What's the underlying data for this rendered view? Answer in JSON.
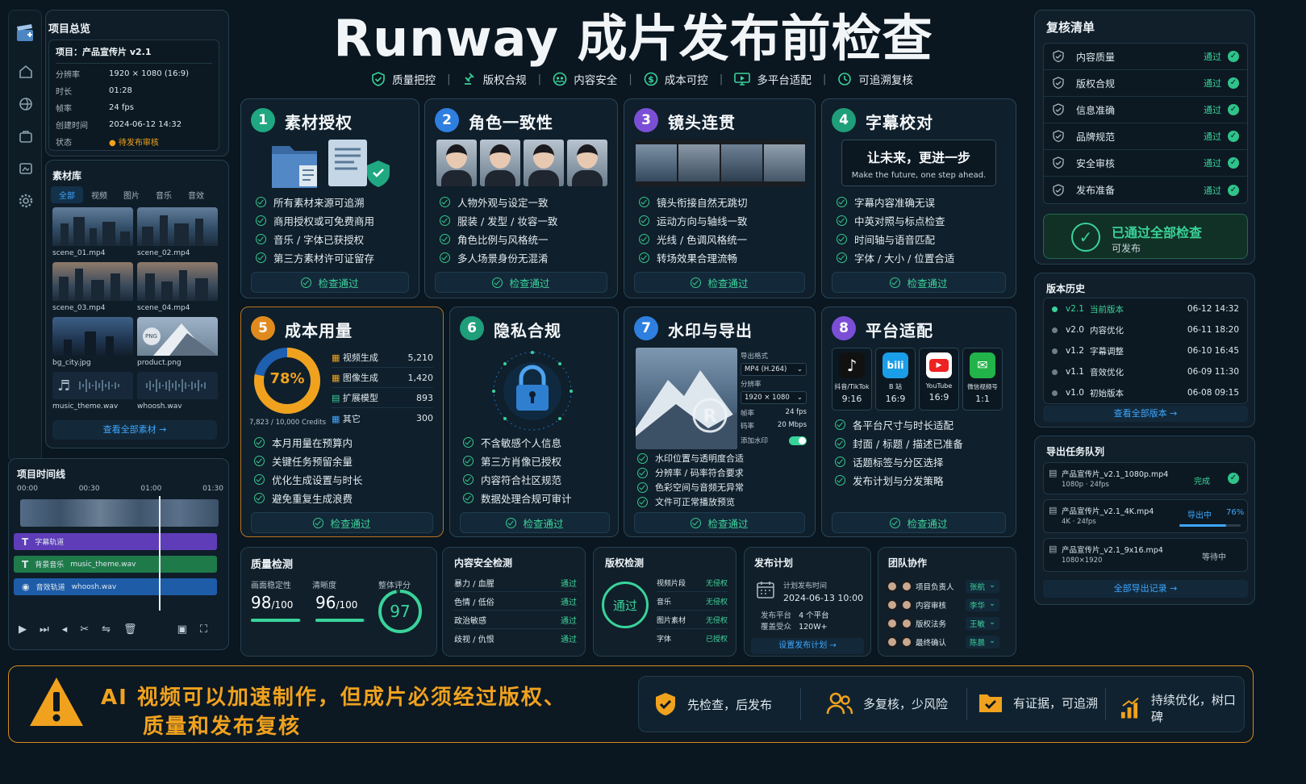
{
  "header": {
    "title": "Runway 成片发布前检查",
    "nav": [
      "质量把控",
      "版权合规",
      "内容安全",
      "成本可控",
      "多平台适配",
      "可追溯复核"
    ]
  },
  "project": {
    "heading": "项目总览",
    "name": "项目：产品宣传片 v2.1",
    "fields": [
      {
        "k": "分辨率",
        "v": "1920 × 1080 (16:9)"
      },
      {
        "k": "时长",
        "v": "01:28"
      },
      {
        "k": "帧率",
        "v": "24 fps"
      },
      {
        "k": "创建时间",
        "v": "2024-06-12 14:32"
      },
      {
        "k": "状态",
        "v": "待发布审核"
      }
    ]
  },
  "library": {
    "heading": "素材库",
    "tabs": [
      "全部",
      "视频",
      "图片",
      "音乐",
      "音效"
    ],
    "items": [
      "scene_01.mp4",
      "scene_02.mp4",
      "scene_03.mp4",
      "scene_04.mp4",
      "bg_city.jpg",
      "product.png",
      "music_theme.wav",
      "whoosh.wav"
    ],
    "png_tag": "PNG",
    "view_all": "查看全部素材 →"
  },
  "timeline": {
    "heading": "项目时间线",
    "marks": [
      "00:00",
      "00:30",
      "01:00",
      "01:30"
    ],
    "tracks": [
      {
        "name": "字幕轨道",
        "file": ""
      },
      {
        "name": "背景音乐",
        "file": "music_theme.wav"
      },
      {
        "name": "音效轨道",
        "file": "whoosh.wav"
      }
    ]
  },
  "cards": {
    "c1": {
      "num": "1",
      "title": "素材授权",
      "checks": [
        "所有素材来源可追溯",
        "商用授权或可免费商用",
        "音乐 / 字体已获授权",
        "第三方素材许可证留存"
      ],
      "pass": "检查通过"
    },
    "c2": {
      "num": "2",
      "title": "角色一致性",
      "checks": [
        "人物外观与设定一致",
        "服装 / 发型 / 妆容一致",
        "角色比例与风格统一",
        "多人场景身份无混淆"
      ],
      "pass": "检查通过"
    },
    "c3": {
      "num": "3",
      "title": "镜头连贯",
      "checks": [
        "镜头衔接自然无跳切",
        "运动方向与轴线一致",
        "光线 / 色调风格统一",
        "转场效果合理流畅"
      ],
      "pass": "检查通过"
    },
    "c4": {
      "num": "4",
      "title": "字幕校对",
      "subtitle_cn": "让未来，更进一步",
      "subtitle_en": "Make the future, one step ahead.",
      "checks": [
        "字幕内容准确无误",
        "中英对照与标点检查",
        "时间轴与语音匹配",
        "字体 / 大小 / 位置合适"
      ],
      "pass": "检查通过"
    },
    "c5": {
      "num": "5",
      "title": "成本用量",
      "percent": "78%",
      "credits": "7,823 / 10,000 Credits",
      "usage": [
        {
          "k": "视频生成",
          "v": "5,210"
        },
        {
          "k": "图像生成",
          "v": "1,420"
        },
        {
          "k": "扩展模型",
          "v": "893"
        },
        {
          "k": "其它",
          "v": "300"
        }
      ],
      "checks": [
        "本月用量在预算内",
        "关键任务预留余量",
        "优化生成设置与时长",
        "避免重复生成浪费"
      ],
      "pass": "检查通过"
    },
    "c6": {
      "num": "6",
      "title": "隐私合规",
      "checks": [
        "不含敏感个人信息",
        "第三方肖像已授权",
        "内容符合社区规范",
        "数据处理合规可审计"
      ],
      "pass": "检查通过"
    },
    "c7": {
      "num": "7",
      "title": "水印与导出",
      "export": {
        "format_label": "导出格式",
        "format": "MP4 (H.264)",
        "res_label": "分辨率",
        "res": "1920 × 1080",
        "fps_label": "帧率",
        "fps": "24 fps",
        "bitrate_label": "码率",
        "bitrate": "20 Mbps",
        "wm_label": "添加水印"
      },
      "checks": [
        "水印位置与透明度合适",
        "分辨率 / 码率符合要求",
        "色彩空间与音频无异常",
        "文件可正常播放预览"
      ],
      "pass": "检查通过"
    },
    "c8": {
      "num": "8",
      "title": "平台适配",
      "platforms": [
        {
          "name": "抖音/TikTok",
          "ratio": "9:16"
        },
        {
          "name": "B 站",
          "ratio": "16:9"
        },
        {
          "name": "YouTube",
          "ratio": "16:9"
        },
        {
          "name": "微信视频号",
          "ratio": "1:1"
        }
      ],
      "checks": [
        "各平台尺寸与时长适配",
        "封面 / 标题 / 描述已准备",
        "话题标签与分区选择",
        "发布计划与分发策略"
      ],
      "pass": "检查通过"
    }
  },
  "quality": {
    "title": "质量检测",
    "labels": [
      "画面稳定性",
      "清晰度",
      "整体评分"
    ],
    "stability": "98",
    "clarity": "96",
    "of": "/100",
    "score": "97"
  },
  "safety": {
    "title": "内容安全检测",
    "rows": [
      {
        "k": "暴力 / 血腥",
        "v": "通过"
      },
      {
        "k": "色情 / 低俗",
        "v": "通过"
      },
      {
        "k": "政治敏感",
        "v": "通过"
      },
      {
        "k": "歧视 / 仇恨",
        "v": "通过"
      }
    ]
  },
  "copyright": {
    "title": "版权检测",
    "badge": "通过",
    "rows": [
      {
        "k": "视频片段",
        "v": "无侵权"
      },
      {
        "k": "音乐",
        "v": "无侵权"
      },
      {
        "k": "图片素材",
        "v": "无侵权"
      },
      {
        "k": "字体",
        "v": "已授权"
      }
    ]
  },
  "publish": {
    "title": "发布计划",
    "time_label": "计划发布时间",
    "time": "2024-06-13 10:00",
    "platform_label": "发布平台",
    "platform": "4 个平台",
    "reach_label": "覆盖受众",
    "reach": "120W+",
    "button": "设置发布计划 →"
  },
  "team": {
    "title": "团队协作",
    "rows": [
      {
        "role": "项目负责人",
        "name": "张航"
      },
      {
        "role": "内容审核",
        "name": "李华"
      },
      {
        "role": "版权法务",
        "name": "王敏"
      },
      {
        "role": "最终确认",
        "name": "陈晨"
      }
    ]
  },
  "review": {
    "title": "复核清单",
    "items": [
      "内容质量",
      "版权合规",
      "信息准确",
      "品牌规范",
      "安全审核",
      "发布准备"
    ],
    "status": "通过",
    "done_title": "已通过全部检查",
    "done_sub": "可发布"
  },
  "history": {
    "title": "版本历史",
    "rows": [
      {
        "v": "v2.1",
        "d": "当前版本",
        "t": "06-12 14:32"
      },
      {
        "v": "v2.0",
        "d": "内容优化",
        "t": "06-11 18:20"
      },
      {
        "v": "v1.2",
        "d": "字幕调整",
        "t": "06-10 16:45"
      },
      {
        "v": "v1.1",
        "d": "音效优化",
        "t": "06-09 11:30"
      },
      {
        "v": "v1.0",
        "d": "初始版本",
        "t": "06-08 09:15"
      }
    ],
    "link": "查看全部版本 →"
  },
  "exports": {
    "title": "导出任务队列",
    "rows": [
      {
        "file": "产品宣传片_v2.1_1080p.mp4",
        "meta": "1080p · 24fps",
        "status": "完成"
      },
      {
        "file": "产品宣传片_v2.1_4K.mp4",
        "meta": "4K · 24fps",
        "status": "导出中",
        "pct": "76%",
        "progress": 0.76
      },
      {
        "file": "产品宣传片_v2.1_9x16.mp4",
        "meta": "1080×1920",
        "status": "等待中"
      }
    ],
    "link": "全部导出记录 →"
  },
  "banner": {
    "line1": "AI 视频可以加速制作，但成片必须经过版权、",
    "line2": "质量和发布复核",
    "tips": [
      "先检查，后发布",
      "多复核，少风险",
      "有证据，可追溯",
      "持续优化，树口碑"
    ]
  },
  "colors": {
    "accent": "#3ea7ff",
    "pass": "#39d39a",
    "warn": "#f0a21e",
    "c1": "#1fa882",
    "c2": "#2e7fe0",
    "c3": "#7a4fd6",
    "c4": "#1f9e7a",
    "c5": "#e08a1e",
    "c6": "#1f9e7a",
    "c7": "#2e7fe0",
    "c8": "#7a4fd6"
  }
}
